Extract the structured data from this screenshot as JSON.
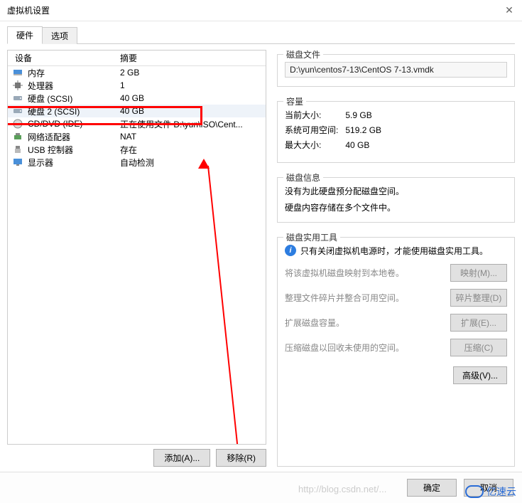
{
  "window": {
    "title": "虚拟机设置"
  },
  "tabs": {
    "hardware": "硬件",
    "options": "选项"
  },
  "list": {
    "header_device": "设备",
    "header_summary": "摘要",
    "rows": [
      {
        "icon": "memory",
        "name": "内存",
        "summary": "2 GB"
      },
      {
        "icon": "cpu",
        "name": "处理器",
        "summary": "1"
      },
      {
        "icon": "disk",
        "name": "硬盘 (SCSI)",
        "summary": "40 GB"
      },
      {
        "icon": "disk",
        "name": "硬盘 2 (SCSI)",
        "summary": "40 GB"
      },
      {
        "icon": "cd",
        "name": "CD/DVD (IDE)",
        "summary": "正在使用文件 D:\\yun\\ISO\\Cent..."
      },
      {
        "icon": "net",
        "name": "网络适配器",
        "summary": "NAT"
      },
      {
        "icon": "usb",
        "name": "USB 控制器",
        "summary": "存在"
      },
      {
        "icon": "display",
        "name": "显示器",
        "summary": "自动检测"
      }
    ]
  },
  "left_buttons": {
    "add": "添加(A)...",
    "remove": "移除(R)"
  },
  "right": {
    "disk_file_group": "磁盘文件",
    "disk_file_value": "D:\\yun\\centos7-13\\CentOS 7-13.vmdk",
    "capacity_group": "容量",
    "cap_current_label": "当前大小:",
    "cap_current_value": "5.9 GB",
    "cap_free_label": "系统可用空间:",
    "cap_free_value": "519.2 GB",
    "cap_max_label": "最大大小:",
    "cap_max_value": "40 GB",
    "disk_info_group": "磁盘信息",
    "disk_info_line1": "没有为此硬盘预分配磁盘空间。",
    "disk_info_line2": "硬盘内容存储在多个文件中。",
    "util_group": "磁盘实用工具",
    "util_hint": "只有关闭虚拟机电源时，才能使用磁盘实用工具。",
    "util_map_text": "将该虚拟机磁盘映射到本地卷。",
    "util_map_btn": "映射(M)...",
    "util_defrag_text": "整理文件碎片并整合可用空间。",
    "util_defrag_btn": "碎片整理(D)",
    "util_expand_text": "扩展磁盘容量。",
    "util_expand_btn": "扩展(E)...",
    "util_compact_text": "压缩磁盘以回收未使用的空间。",
    "util_compact_btn": "压缩(C)",
    "advanced_btn": "高级(V)..."
  },
  "footer": {
    "ok": "确定",
    "cancel": "取消"
  },
  "watermark_text": "亿速云",
  "faint_url": "http://blog.csdn.net/..."
}
